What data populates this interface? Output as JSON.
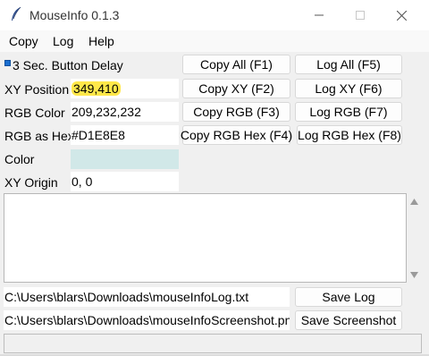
{
  "window": {
    "title": "MouseInfo 0.1.3"
  },
  "menu": {
    "items": [
      "Copy",
      "Log",
      "Help"
    ]
  },
  "delay": {
    "label": "3 Sec. Button Delay",
    "checked": true
  },
  "fields": {
    "xy_position": {
      "label": "XY Position",
      "value": "349,410"
    },
    "rgb_color": {
      "label": "RGB Color",
      "value": "209,232,232"
    },
    "rgb_hex": {
      "label": "RGB as Hex",
      "value": "#D1E8E8"
    },
    "color": {
      "label": "Color",
      "swatch": "#D1E8E8"
    },
    "xy_origin": {
      "label": "XY Origin",
      "value": "0, 0"
    }
  },
  "buttons": {
    "copy_all": "Copy All (F1)",
    "log_all": "Log All (F5)",
    "copy_xy": "Copy XY (F2)",
    "log_xy": "Log XY (F6)",
    "copy_rgb": "Copy RGB (F3)",
    "log_rgb": "Log RGB (F7)",
    "copy_rgb_hex": "Copy RGB Hex (F4)",
    "log_rgb_hex": "Log RGB Hex (F8)",
    "save_log": "Save Log",
    "save_screenshot": "Save Screenshot"
  },
  "paths": {
    "log_file": "C:\\Users\\blars\\Downloads\\mouseInfoLog.txt",
    "screenshot_file": "C:\\Users\\blars\\Downloads\\mouseInfoScreenshot.png"
  },
  "log_text": "",
  "colors": {
    "highlight": "#FFE84A",
    "checkbox": "#1A6FD0"
  }
}
